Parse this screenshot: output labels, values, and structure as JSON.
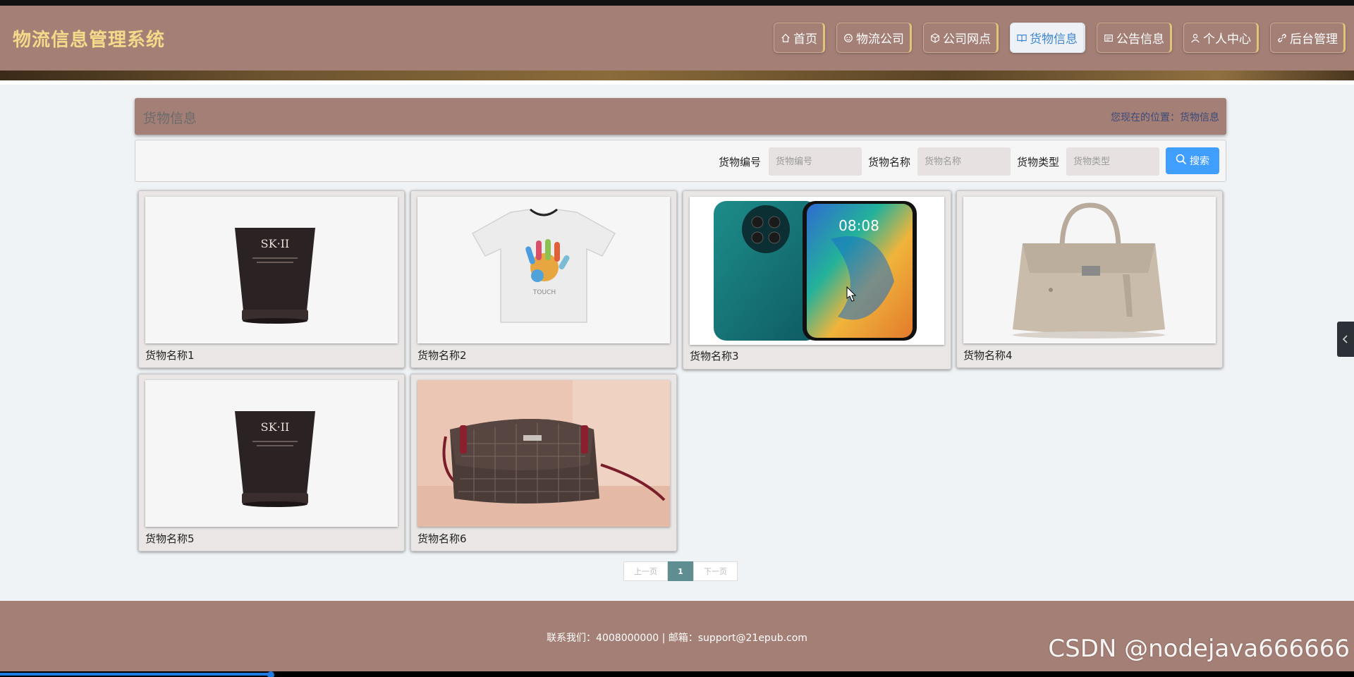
{
  "app_title": "物流信息管理系统",
  "nav": [
    {
      "label": "首页",
      "icon": "home-icon",
      "active": false
    },
    {
      "label": "物流公司",
      "icon": "company-icon",
      "active": false
    },
    {
      "label": "公司网点",
      "icon": "cube-icon",
      "active": false
    },
    {
      "label": "货物信息",
      "icon": "book-icon",
      "active": true
    },
    {
      "label": "公告信息",
      "icon": "notice-icon",
      "active": false
    },
    {
      "label": "个人中心",
      "icon": "user-icon",
      "active": false
    },
    {
      "label": "后台管理",
      "icon": "link-icon",
      "active": false
    }
  ],
  "page_title": "货物信息",
  "location": {
    "label": "您现在的位置：",
    "current": "货物信息"
  },
  "search": {
    "fields": [
      {
        "label": "货物编号",
        "placeholder": "货物编号"
      },
      {
        "label": "货物名称",
        "placeholder": "货物名称"
      },
      {
        "label": "货物类型",
        "placeholder": "货物类型"
      }
    ],
    "button": "搜索"
  },
  "items": [
    {
      "name": "货物名称1",
      "image": "skincare-tube"
    },
    {
      "name": "货物名称2",
      "image": "white-tshirt"
    },
    {
      "name": "货物名称3",
      "image": "smartphone"
    },
    {
      "name": "货物名称4",
      "image": "beige-handbag"
    },
    {
      "name": "货物名称5",
      "image": "skincare-tube"
    },
    {
      "name": "货物名称6",
      "image": "crossbody-bag"
    }
  ],
  "pagination": {
    "prev": "上一页",
    "current": "1",
    "next": "下一页"
  },
  "footer": "联系我们：4008000000 | 邮箱：support@21epub.com",
  "watermark": "CSDN @nodejava666666",
  "video_progress": 0.2,
  "colors": {
    "primary": "#a47f76",
    "accent": "#409eff",
    "logo": "#f5d98a"
  }
}
